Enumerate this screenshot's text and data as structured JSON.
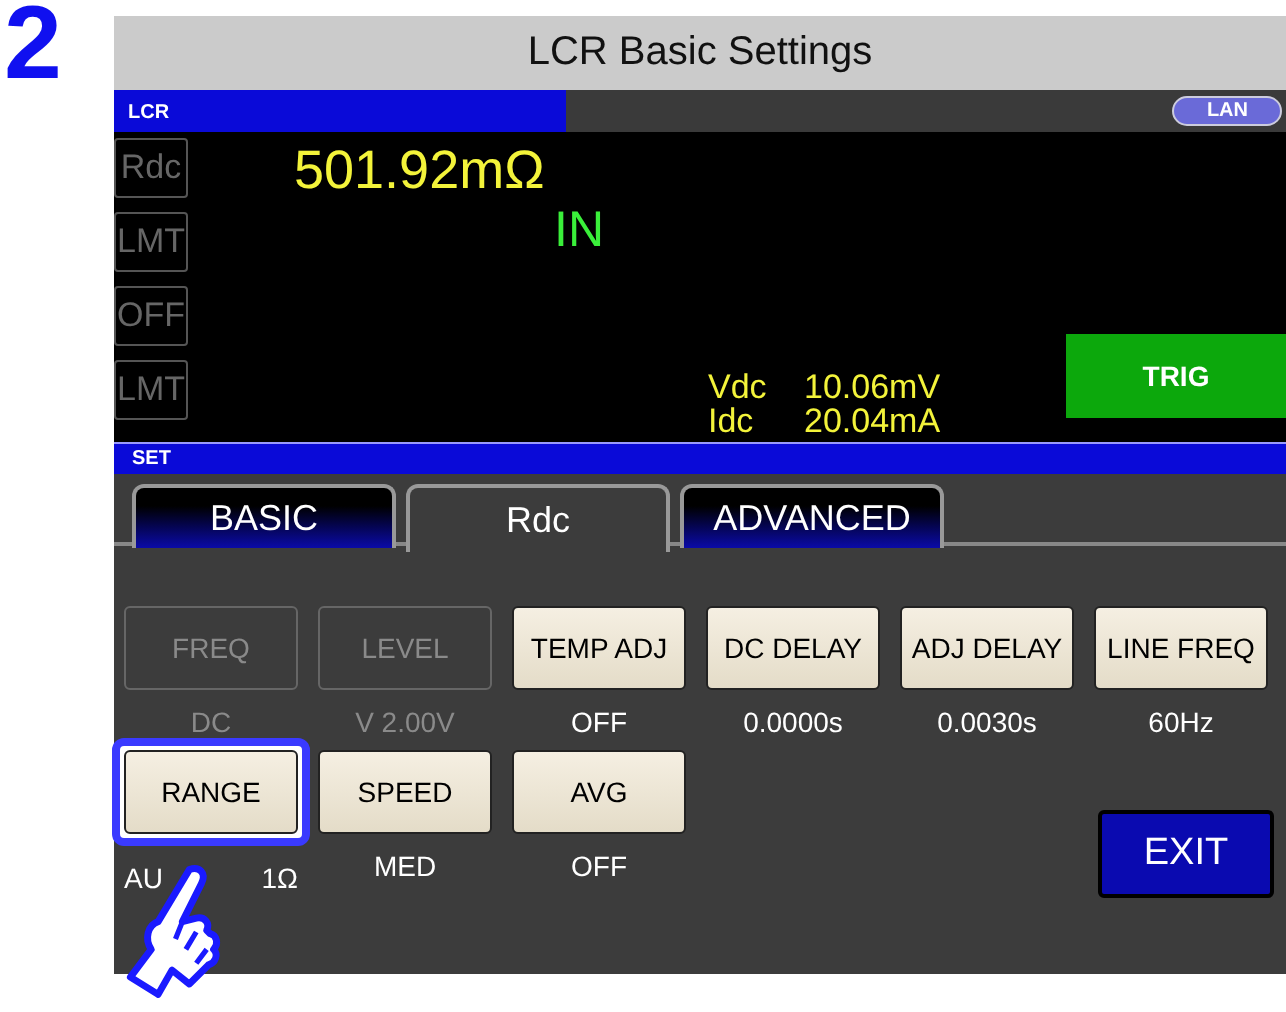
{
  "step": "2",
  "window": {
    "title": "LCR Basic Settings"
  },
  "header": {
    "label": "LCR",
    "badge": "LAN"
  },
  "side_labels": [
    {
      "text": "Rdc"
    },
    {
      "text": "LMT"
    },
    {
      "text": "OFF"
    },
    {
      "text": "LMT"
    }
  ],
  "measurement": {
    "value": "501.92mΩ",
    "judgement": "IN"
  },
  "readings": [
    {
      "name": "Vdc",
      "value": "10.06mV"
    },
    {
      "name": "Idc",
      "value": "20.04mA"
    }
  ],
  "trig_button": "TRIG",
  "set_bar": "SET",
  "tabs": [
    {
      "label": "BASIC",
      "selected": false
    },
    {
      "label": "Rdc",
      "selected": true
    },
    {
      "label": "ADVANCED",
      "selected": false
    }
  ],
  "rows": [
    [
      {
        "label": "FREQ",
        "disabled": true,
        "highlighted": false,
        "values": [
          "DC"
        ]
      },
      {
        "label": "LEVEL",
        "disabled": true,
        "highlighted": false,
        "values": [
          "V 2.00V"
        ]
      },
      {
        "label": "TEMP ADJ",
        "disabled": false,
        "highlighted": false,
        "values": [
          "OFF"
        ]
      },
      {
        "label": "DC DELAY",
        "disabled": false,
        "highlighted": false,
        "values": [
          "0.0000s"
        ]
      },
      {
        "label": "ADJ DELAY",
        "disabled": false,
        "highlighted": false,
        "values": [
          "0.0030s"
        ]
      },
      {
        "label": "LINE FREQ",
        "disabled": false,
        "highlighted": false,
        "values": [
          "60Hz"
        ]
      }
    ],
    [
      {
        "label": "RANGE",
        "disabled": false,
        "highlighted": true,
        "values": [
          "AU",
          "1Ω"
        ]
      },
      {
        "label": "SPEED",
        "disabled": false,
        "highlighted": false,
        "values": [
          "MED"
        ]
      },
      {
        "label": "AVG",
        "disabled": false,
        "highlighted": false,
        "values": [
          "OFF"
        ]
      }
    ]
  ],
  "exit_button": "EXIT"
}
